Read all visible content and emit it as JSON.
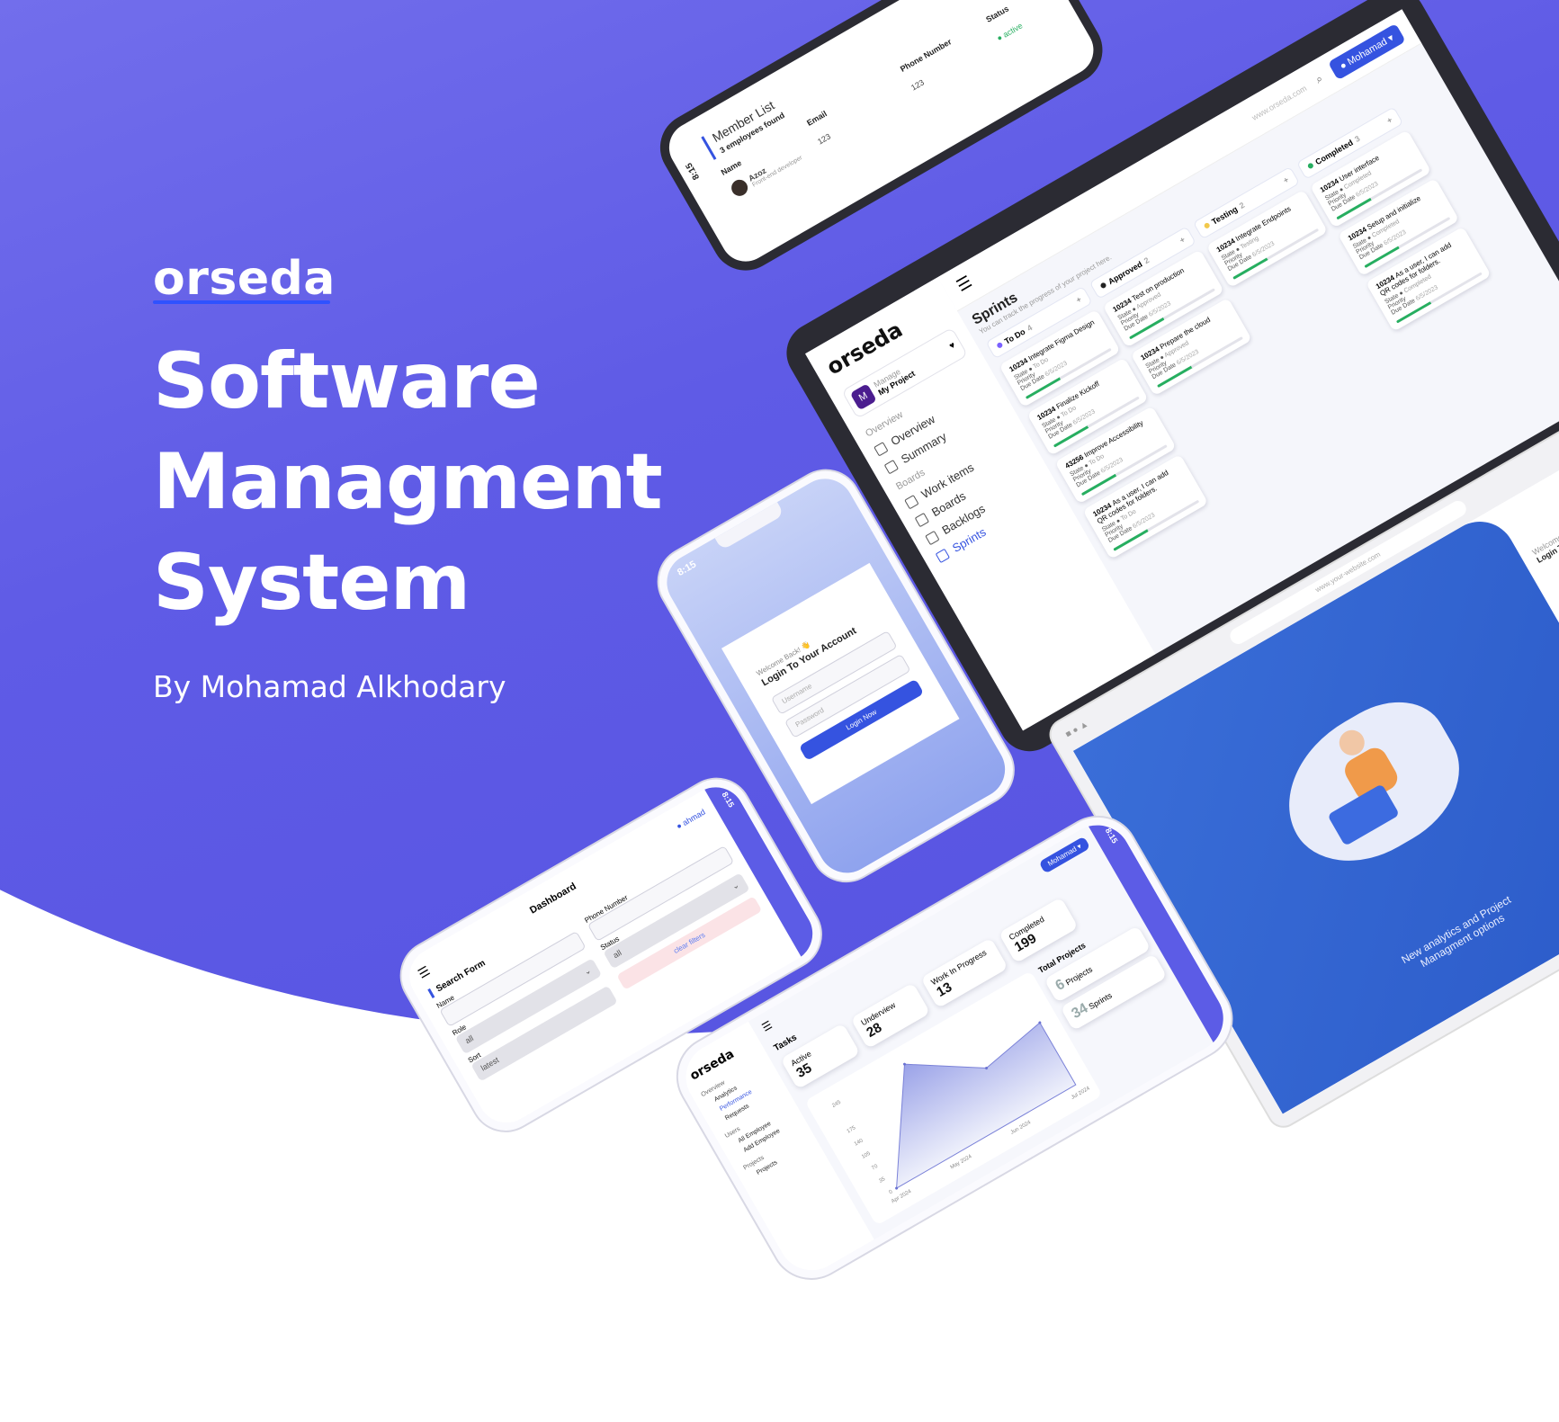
{
  "hero": {
    "brand": "orseda",
    "title_line1": "Software",
    "title_line2": "Managment",
    "title_line3": "System",
    "byline": "By Mohamad Alkhodary"
  },
  "member_list": {
    "title": "Member List",
    "count_text": "3 employees found",
    "columns": [
      "Name",
      "Email",
      "Phone Number",
      "Status"
    ],
    "rows": [
      {
        "name": "Azoz",
        "subtitle": "Front-end developer",
        "email": "123",
        "phone": "123",
        "status": "active"
      }
    ],
    "time": "8:15"
  },
  "tablet": {
    "logo": "orseda",
    "url": "www.orseda.com",
    "user_button": "Mohamad",
    "project_label": "Manage",
    "project_name": "My Project",
    "project_initial": "M",
    "section_overview": "Overview",
    "nav_overview": "Overview",
    "nav_summary": "Summary",
    "section_boards": "Boards",
    "nav_work_items": "Work items",
    "nav_boards": "Boards",
    "nav_backlogs": "Backlogs",
    "nav_sprints": "Sprints",
    "page_title": "Sprints",
    "page_subtitle": "You can track the progress of your project here.",
    "columns": [
      {
        "label": "To Do",
        "count": "4",
        "color": "#7b61ff"
      },
      {
        "label": "Approved",
        "count": "2",
        "color": "#222222"
      },
      {
        "label": "Testing",
        "count": "2",
        "color": "#f2c94c"
      },
      {
        "label": "Completed",
        "count": "3",
        "color": "#27ae60"
      }
    ],
    "card_state_label": "State",
    "card_priority_label": "Priority",
    "card_due_label": "Due Date",
    "cards": [
      {
        "col": 0,
        "id": "10234",
        "title": "Integrate Figma Design",
        "state": "To Do",
        "due": "6/5/2023"
      },
      {
        "col": 0,
        "id": "10234",
        "title": "Finalize Kickoff",
        "state": "To Do",
        "due": "6/5/2023"
      },
      {
        "col": 0,
        "id": "43256",
        "title": "Improve Accessibility",
        "state": "To Do",
        "due": "6/5/2023"
      },
      {
        "col": 0,
        "id": "10234",
        "title": "As a user, I can add QR codes for folders.",
        "state": "To Do",
        "due": "6/5/2023"
      },
      {
        "col": 1,
        "id": "10234",
        "title": "Test on production",
        "state": "Approved",
        "due": "6/5/2023"
      },
      {
        "col": 1,
        "id": "10234",
        "title": "Prepare the cloud",
        "state": "Approved",
        "due": "6/5/2023"
      },
      {
        "col": 2,
        "id": "10234",
        "title": "Integrate Endpoints",
        "state": "Testing",
        "due": "6/5/2023"
      },
      {
        "col": 3,
        "id": "10234",
        "title": "User interface",
        "state": "Completed",
        "due": "6/5/2023"
      },
      {
        "col": 3,
        "id": "10234",
        "title": "Setup and initialize",
        "state": "Completed",
        "due": "6/5/2023"
      },
      {
        "col": 3,
        "id": "10234",
        "title": "As a user, I can add QR codes for folders.",
        "state": "Completed",
        "due": "6/5/2023"
      }
    ]
  },
  "login_phone": {
    "time": "8:15",
    "welcome": "Welcome Back! 👋",
    "heading": "Login To Your Account",
    "username_placeholder": "Username",
    "password_placeholder": "Password",
    "button": "Login Now"
  },
  "browser": {
    "url": "www.your-website.com",
    "caption_line1": "New analytics and Project",
    "caption_line2": "Managment options",
    "side_welcome": "Welcome Ba",
    "side_heading": "Login To Yo"
  },
  "search_phone": {
    "time": "8:15",
    "user": "ahmad",
    "header": "Dashboard",
    "form_title": "Search Form",
    "name_label": "Name",
    "phone_label": "Phone Number",
    "role_label": "Role",
    "role_value": "all",
    "status_label": "Status",
    "status_value": "all",
    "sort_label": "Sort",
    "sort_value": "latest",
    "clear_button": "clear filters"
  },
  "dashboard_phone": {
    "time": "8:15",
    "logo": "orseda",
    "user_button": "Mohamad",
    "nav": [
      {
        "label": "Overview",
        "kind": "section"
      },
      {
        "label": "Analytics",
        "kind": "item"
      },
      {
        "label": "Performance",
        "kind": "item-active"
      },
      {
        "label": "Requests",
        "kind": "item"
      },
      {
        "label": "Users",
        "kind": "section"
      },
      {
        "label": "All Employee",
        "kind": "item"
      },
      {
        "label": "Add Employee",
        "kind": "item"
      },
      {
        "label": "Projects",
        "kind": "section"
      },
      {
        "label": "Projects",
        "kind": "item"
      }
    ],
    "tasks_title": "Tasks",
    "stats": [
      {
        "label": "Active",
        "value": "35"
      },
      {
        "label": "Underview",
        "value": "28"
      },
      {
        "label": "Work In Progress",
        "value": "13"
      },
      {
        "label": "Completed",
        "value": "199"
      }
    ],
    "total_projects_title": "Total Projects",
    "projects_count": "6",
    "projects_label": "Projects",
    "sprints_count": "34",
    "sprints_label": "Sprints"
  },
  "chart_data": {
    "type": "area",
    "title": "",
    "x": [
      "Apr 2024",
      "May 2024",
      "Jun 2024",
      "Jul 2024"
    ],
    "y_ticks": [
      0,
      35,
      70,
      105,
      140,
      175,
      245
    ],
    "series": [
      {
        "values": [
          0,
          245,
          140,
          170
        ]
      }
    ],
    "xlabel": "",
    "ylabel": "",
    "ylim": [
      0,
      245
    ]
  }
}
